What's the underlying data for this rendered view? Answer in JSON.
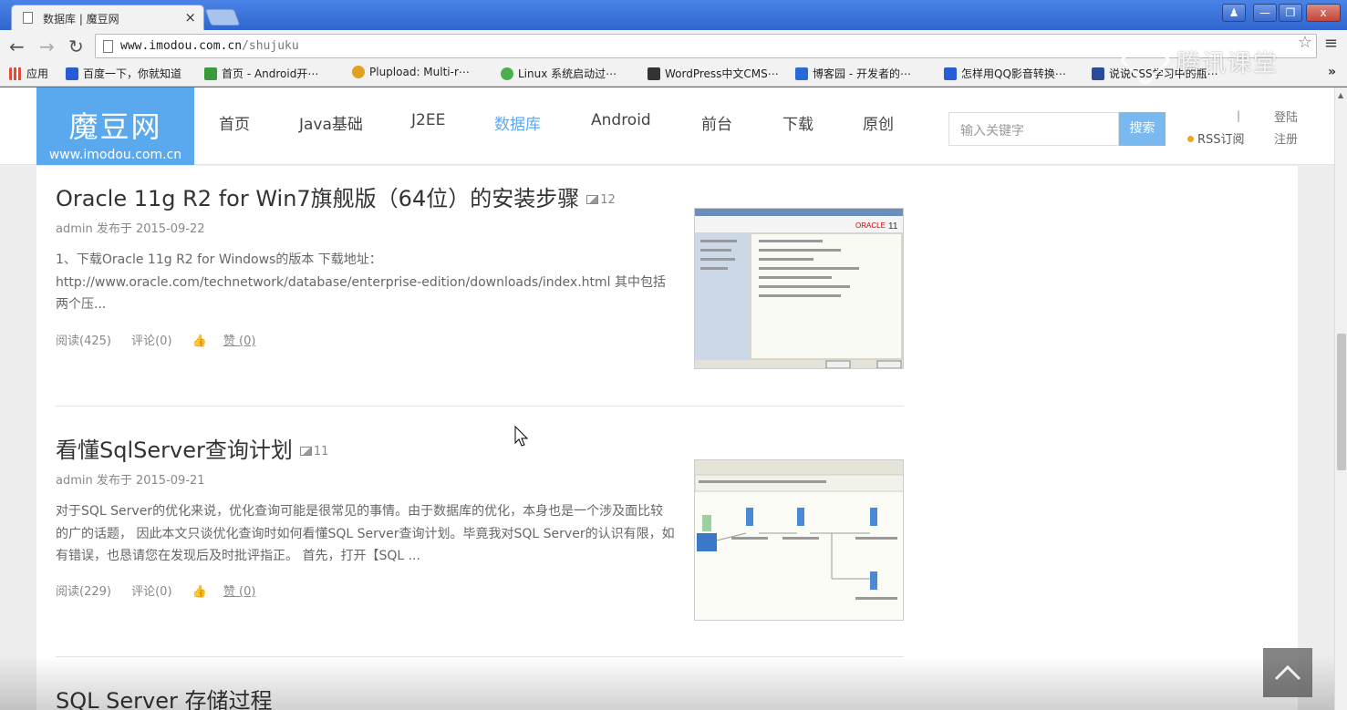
{
  "browser": {
    "tab_title": "数据库 | 魔豆网",
    "tab_close": "×",
    "url_host": "www.imodou.com.cn",
    "url_path": "/shujuku",
    "window_buttons": [
      "♟",
      "—",
      "❐",
      "x"
    ],
    "star": "☆",
    "menu": "≡"
  },
  "bookmarks": [
    {
      "label": "应用",
      "color": "#e04b3a"
    },
    {
      "label": "百度一下，你就知道",
      "color": "#2a5bd7"
    },
    {
      "label": "首页 - Android开⋯",
      "color": "#3a9a3a"
    },
    {
      "label": "Plupload: Multi-r⋯",
      "color": "#e0a020"
    },
    {
      "label": "Linux 系统启动过⋯",
      "color": "#4bb04b"
    },
    {
      "label": "WordPress中文CMS⋯",
      "color": "#333333"
    },
    {
      "label": "博客园 - 开发者的⋯",
      "color": "#2a6ad7"
    },
    {
      "label": "怎样用QQ影音转换⋯",
      "color": "#2a5bd7"
    },
    {
      "label": "说说CSS学习中的瓶⋯",
      "color": "#2a4a9a"
    }
  ],
  "bookmarks_more": "»",
  "watermark": "腾讯课堂",
  "site": {
    "logo_main": "魔豆网",
    "logo_sub": "www.imodou.com.cn",
    "nav": [
      "首页",
      "Java基础",
      "J2EE",
      "数据库",
      "Android",
      "前台",
      "下载",
      "原创"
    ],
    "active_nav": "数据库",
    "search_placeholder": "输入关键字",
    "search_button": "搜索",
    "separator": "|",
    "rss": "RSS订阅",
    "login": "登陆",
    "register": "注册"
  },
  "articles": [
    {
      "title": "Oracle 11g R2 for Win7旗舰版（64位）的安装步骤",
      "pics": "12",
      "meta": "admin 发布于 2015-09-22",
      "summary": "1、下载Oracle 11g R2 for Windows的版本  下载地址：http://www.oracle.com/technetwork/database/enterprise-edition/downloads/index.html  其中包括两个压...",
      "reads": "阅读(425)",
      "comments": "评论(0)",
      "likes": "赞 (0)"
    },
    {
      "title": "看懂SqlServer查询计划",
      "pics": "11",
      "meta": "admin 发布于 2015-09-21",
      "summary": "对于SQL Server的优化来说，优化查询可能是很常见的事情。由于数据库的优化，本身也是一个涉及面比较的广的话题， 因此本文只谈优化查询时如何看懂SQL Server查询计划。毕竟我对SQL Server的认识有限，如有错误，也恳请您在发现后及时批评指正。 首先，打开【SQL ...",
      "reads": "阅读(229)",
      "comments": "评论(0)",
      "likes": "赞 (0)"
    },
    {
      "title": "SQL Server 存储过程"
    }
  ],
  "colors": {
    "accent": "#5aa9ef",
    "search_button": "#79b9f0",
    "rss_dot": "#f0a420",
    "titlebar": "#3c6fd1"
  }
}
